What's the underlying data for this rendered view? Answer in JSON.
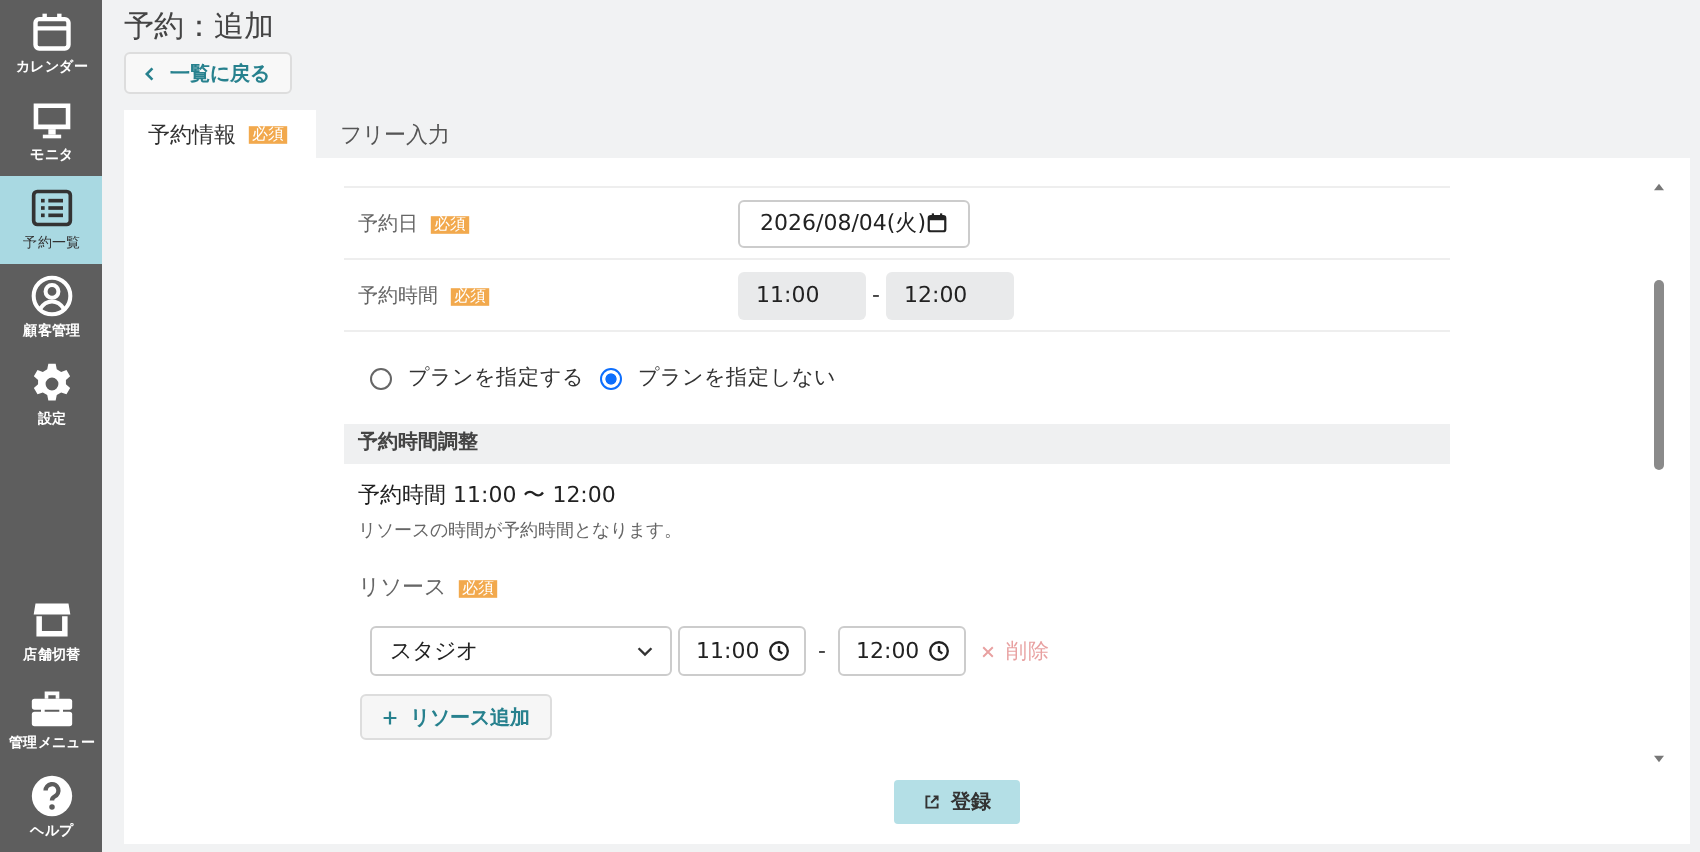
{
  "sidebar": {
    "items": [
      {
        "kind": "calendar",
        "label": "カレンダー",
        "selected": false
      },
      {
        "kind": "monitor",
        "label": "モニタ",
        "selected": false
      },
      {
        "kind": "list",
        "label": "予約一覧",
        "selected": true
      },
      {
        "kind": "person",
        "label": "顧客管理",
        "selected": false
      },
      {
        "kind": "gear",
        "label": "設定",
        "selected": false
      }
    ],
    "bottom_items": [
      {
        "kind": "store",
        "label": "店舗切替",
        "selected": false
      },
      {
        "kind": "toolbox",
        "label": "管理メニュー",
        "selected": false
      },
      {
        "kind": "help",
        "label": "ヘルプ",
        "selected": false
      }
    ]
  },
  "page_title": "予約：追加",
  "back_button": "一覧に戻る",
  "tabs": [
    {
      "label": "予約情報",
      "badge": "必須",
      "selected": true
    },
    {
      "label": "フリー入力",
      "selected": false
    }
  ],
  "form": {
    "date": {
      "label": "予約日",
      "badge": "必須",
      "value": "2026/08/04(火)"
    },
    "time": {
      "label": "予約時間",
      "badge": "必須",
      "start": "11:00",
      "separator": "-",
      "end": "12:00",
      "disabled": true
    },
    "plan_options": [
      {
        "label": "プランを指定する",
        "selected": false
      },
      {
        "label": "プランを指定しない",
        "selected": true
      }
    ],
    "section_title": "予約時間調整",
    "summary": "予約時間 11:00 〜 12:00",
    "note": "リソースの時間が予約時間となります。",
    "resource": {
      "label": "リソース",
      "badge": "必須"
    },
    "resource_rows": [
      {
        "name": "スタジオ",
        "start": "11:00",
        "separator": "-",
        "end": "12:00",
        "delete_label": "削除"
      }
    ],
    "add_button": "リソース追加",
    "submit_button": "登録"
  }
}
